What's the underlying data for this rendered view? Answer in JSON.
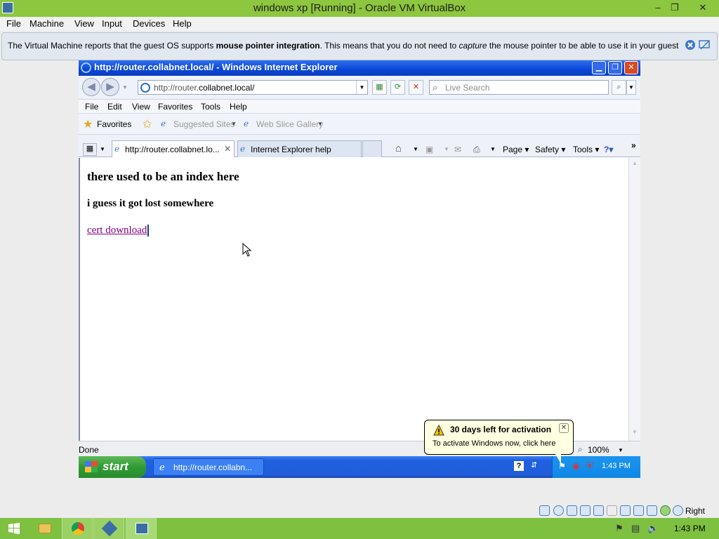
{
  "vbox": {
    "title": "windows xp [Running] - Oracle VM VirtualBox",
    "window_controls": [
      "–",
      "❐",
      "✕"
    ],
    "menu": [
      "File",
      "Machine",
      "View",
      "Input",
      "Devices",
      "Help"
    ],
    "notice": {
      "prefix": "The Virtual Machine reports that the guest OS supports ",
      "bold": "mouse pointer integration",
      "middle": ". This means that you do not need to ",
      "italic": "capture",
      "suffix": " the mouse pointer to be able to use it in your guest OS -- all mouse"
    },
    "status_host_key": "Right Ctrl"
  },
  "ie": {
    "title": "http://router.collabnet.local/ - Windows Internet Explorer",
    "address_prefix": "http://router.",
    "address_domain": "collabnet.local/",
    "search_placeholder": "Live Search",
    "menu": [
      "File",
      "Edit",
      "View",
      "Favorites",
      "Tools",
      "Help"
    ],
    "favorites": {
      "favorites_label": "Favorites",
      "suggested_sites": "Suggested Sites",
      "web_slice_gallery": "Web Slice Gallery"
    },
    "tabs": [
      {
        "label": "http://router.collabnet.lo...",
        "active": true
      },
      {
        "label": "Internet Explorer help",
        "active": false
      }
    ],
    "command_bar": {
      "page": "Page",
      "safety": "Safety",
      "tools": "Tools"
    },
    "status": "Done",
    "zoom": "100%"
  },
  "page": {
    "heading": "there used to be an index here",
    "subheading": "i guess it got lost somewhere",
    "link": "cert download"
  },
  "xp": {
    "start_label": "start",
    "task_label": "http://router.collabn...",
    "clock": "1:43 PM",
    "balloon": {
      "title": "30 days left for activation",
      "body": "To activate Windows now, click here"
    }
  },
  "host": {
    "clock": "1:43 PM"
  },
  "colors": {
    "vbox_title_bg": "#8dc63f",
    "host_taskbar_bg": "#7ec141",
    "xp_blue": "#225ed9",
    "visited_link": "#800080"
  }
}
